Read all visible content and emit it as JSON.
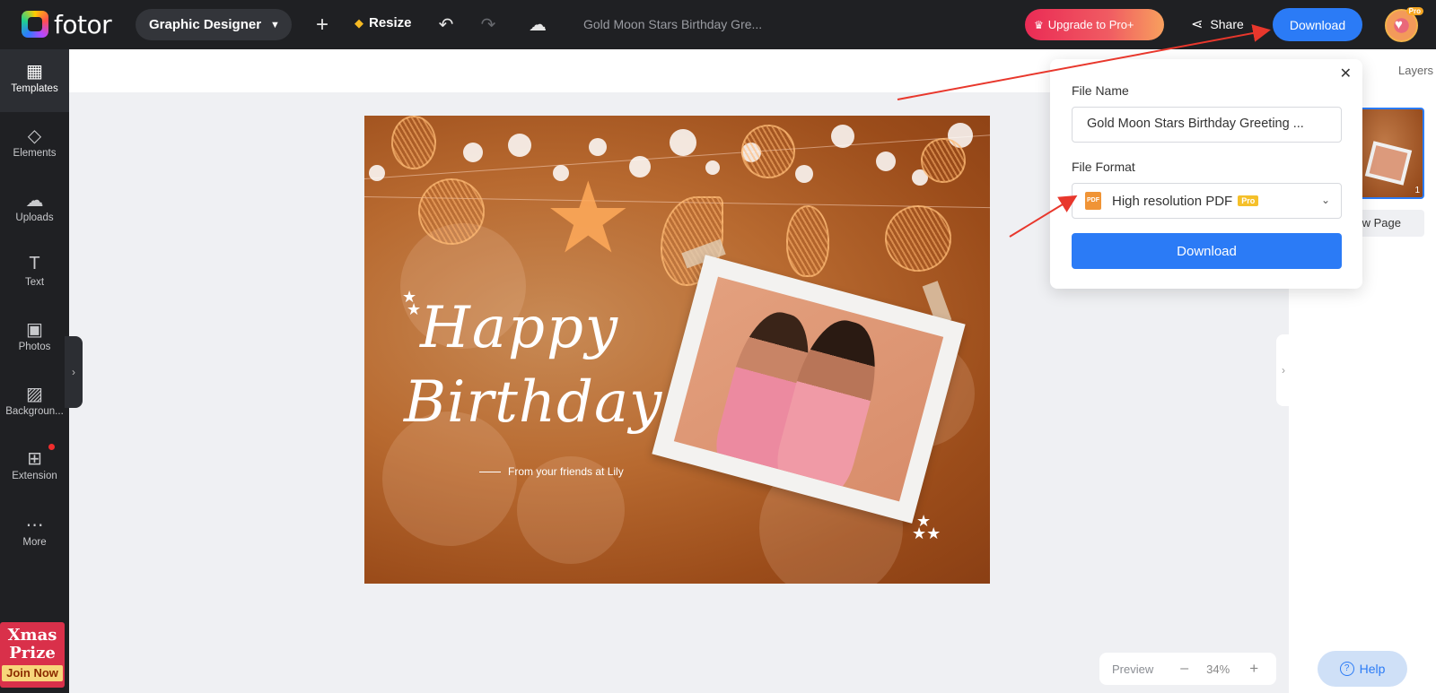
{
  "topbar": {
    "logo_text": "fotor",
    "mode_label": "Graphic Designer",
    "resize_label": "Resize",
    "doc_title": "Gold Moon Stars Birthday Gre...",
    "upgrade_label": "Upgrade to Pro+",
    "share_label": "Share",
    "download_label": "Download",
    "avatar_badge": "Pro",
    "icons": [
      "plus-icon",
      "undo-icon",
      "redo-icon",
      "cloud-save-icon",
      "share-icon",
      "crown-icon",
      "gem-icon"
    ]
  },
  "sidebar": {
    "items": [
      {
        "label": "Templates",
        "icon": "templates-icon",
        "glyph": "▦"
      },
      {
        "label": "Elements",
        "icon": "elements-icon",
        "glyph": "◇"
      },
      {
        "label": "Uploads",
        "icon": "upload-icon",
        "glyph": "☁"
      },
      {
        "label": "Text",
        "icon": "text-icon",
        "glyph": "T"
      },
      {
        "label": "Photos",
        "icon": "photos-icon",
        "glyph": "▣"
      },
      {
        "label": "Backgroun...",
        "icon": "background-icon",
        "glyph": "▨"
      },
      {
        "label": "Extension",
        "icon": "extension-icon",
        "glyph": "⊞"
      },
      {
        "label": "More",
        "icon": "more-icon",
        "glyph": "⋯"
      }
    ],
    "promo_line1": "Xmas",
    "promo_line2": "Prize",
    "promo_cta": "Join Now"
  },
  "card": {
    "line1": "Happy",
    "line2": "Birthday",
    "from_text": "From your friends at Lily"
  },
  "zoom": {
    "preview_label": "Preview",
    "minus": "–",
    "value": "34%",
    "plus": "+"
  },
  "right_panel": {
    "layers_label": "Layers",
    "page_number": "1",
    "new_page_label": "New Page",
    "help_label": "Help"
  },
  "download_popover": {
    "close": "✕",
    "file_name_label": "File Name",
    "file_name_value": "Gold Moon Stars Birthday Greeting ...",
    "file_format_label": "File Format",
    "file_format_value": "High resolution PDF",
    "pro_tag": "Pro",
    "pdf_icon_text": "PDF",
    "download_label": "Download"
  },
  "colors": {
    "accent": "#2b7bf6",
    "topbar_bg": "#1f2023",
    "annotation_arrow": "#e8372c"
  }
}
